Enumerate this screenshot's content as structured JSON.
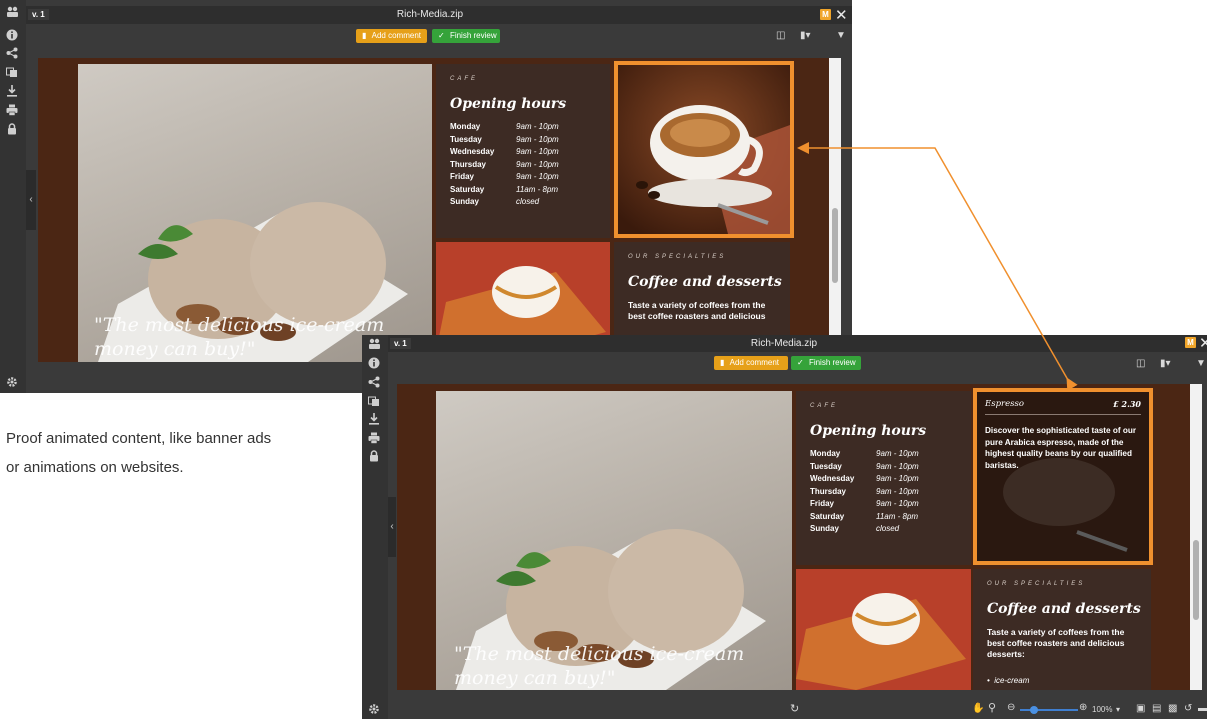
{
  "window": {
    "title": "Rich-Media.zip",
    "version": "v. 1",
    "badge": "M",
    "close_glyph": "✕",
    "add_comment": "Add comment",
    "finish_review": "Finish review"
  },
  "sidebar_icons": [
    "users-icon",
    "info-icon",
    "share-icon",
    "compare-icon",
    "download-icon",
    "print-icon",
    "lock-icon"
  ],
  "page": {
    "cafe_label": "CAFE",
    "opening_title": "Opening hours",
    "hours": [
      {
        "day": "Monday",
        "time": "9am - 10pm"
      },
      {
        "day": "Tuesday",
        "time": "9am - 10pm"
      },
      {
        "day": "Wednesday",
        "time": "9am - 10pm"
      },
      {
        "day": "Thursday",
        "time": "9am - 10pm"
      },
      {
        "day": "Friday",
        "time": "9am - 10pm"
      },
      {
        "day": "Saturday",
        "time": "11am - 8pm"
      },
      {
        "day": "Sunday",
        "time": "closed"
      }
    ],
    "specialties_label": "OUR SPECIALTIES",
    "specialties_title": "Coffee and desserts",
    "specialties_text": "Taste a variety of coffees from the best coffee roasters and delicious",
    "specialties_text_full": "Taste a variety of coffees from the best coffee roasters and delicious desserts:",
    "specialties_bullet": "ice-cream",
    "quote_line1": "\"The most delicious ice-cream",
    "quote_line2": "money can buy!\"",
    "espresso_name": "Espresso",
    "espresso_price": "£ 2.30",
    "espresso_desc": "Discover the sophisticated taste of our pure Arabica espresso, made of the highest quality beans by our qualified baristas."
  },
  "zoom": "100%",
  "caption_line1": "Proof animated content, like banner ads",
  "caption_line2": "or animations on websites.",
  "colors": {
    "accent_orange": "#f0902e",
    "add_comment": "#e6a019",
    "finish_review": "#35a33a",
    "page_brown": "#4b2614"
  }
}
